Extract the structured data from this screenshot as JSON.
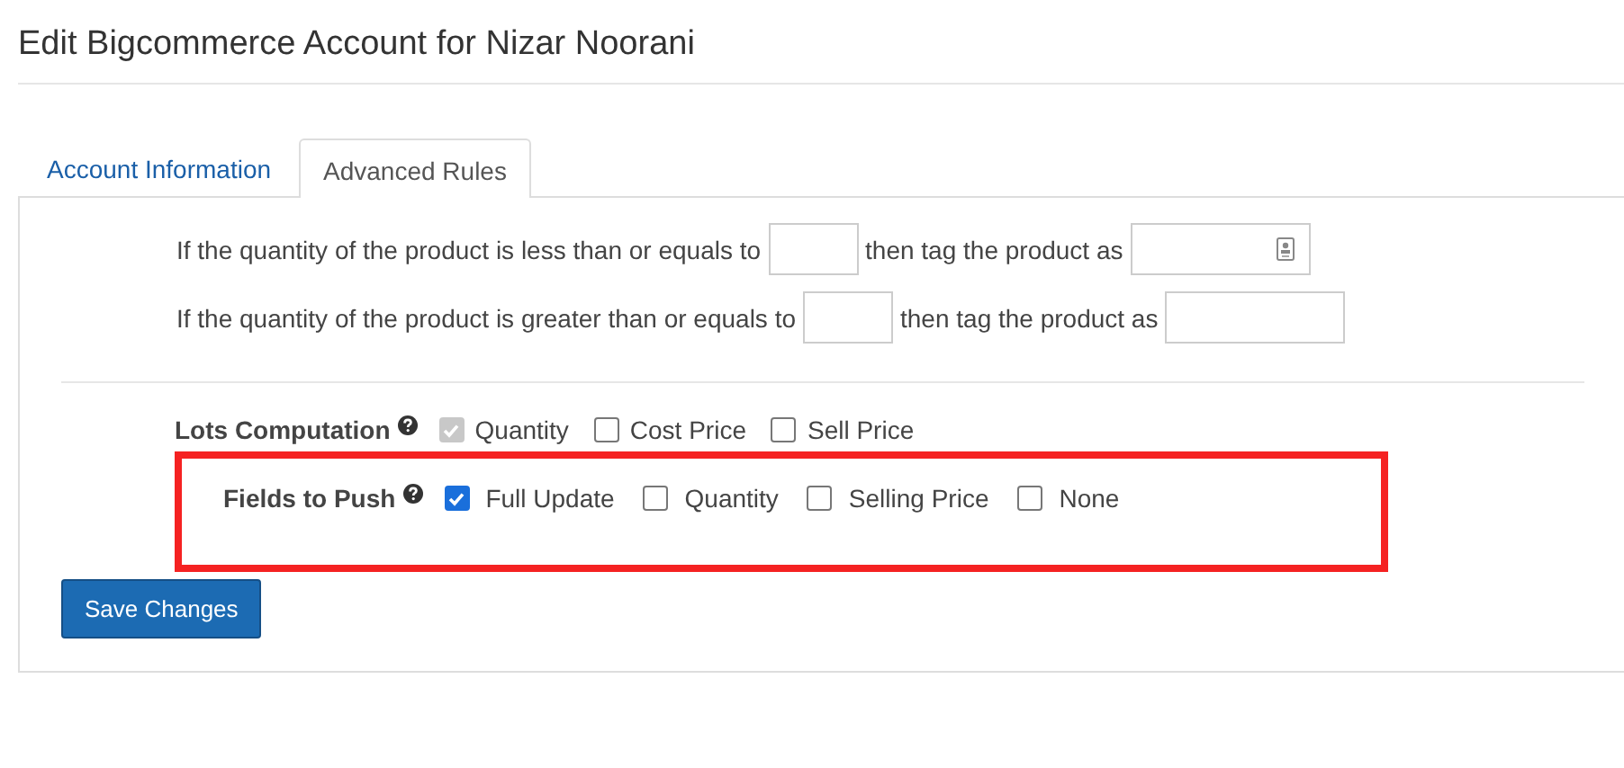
{
  "page_title": "Edit Bigcommerce Account for Nizar Noorani",
  "tabs": [
    {
      "label": "Account Information",
      "selected": false
    },
    {
      "label": "Advanced Rules",
      "selected": true
    }
  ],
  "rules": [
    {
      "condition": "If the quantity of the product is less than or equals to",
      "action": "then tag the product as",
      "tag_has_icon": true
    },
    {
      "condition": "If the quantity of the product is greater than or equals to",
      "action": "then tag the product as",
      "tag_has_icon": false
    }
  ],
  "option_groups": [
    {
      "label": "Lots Computation",
      "highlighted": false,
      "options": [
        {
          "label": "Quantity",
          "checked": true,
          "disabled": true
        },
        {
          "label": "Cost Price",
          "checked": false,
          "disabled": false
        },
        {
          "label": "Sell Price",
          "checked": false,
          "disabled": false
        }
      ]
    },
    {
      "label": "Fields to Push",
      "highlighted": true,
      "options": [
        {
          "label": "Full Update",
          "checked": true,
          "disabled": false
        },
        {
          "label": "Quantity",
          "checked": false,
          "disabled": false
        },
        {
          "label": "Selling Price",
          "checked": false,
          "disabled": false
        },
        {
          "label": "None",
          "checked": false,
          "disabled": false
        }
      ]
    }
  ],
  "save_button": "Save Changes"
}
